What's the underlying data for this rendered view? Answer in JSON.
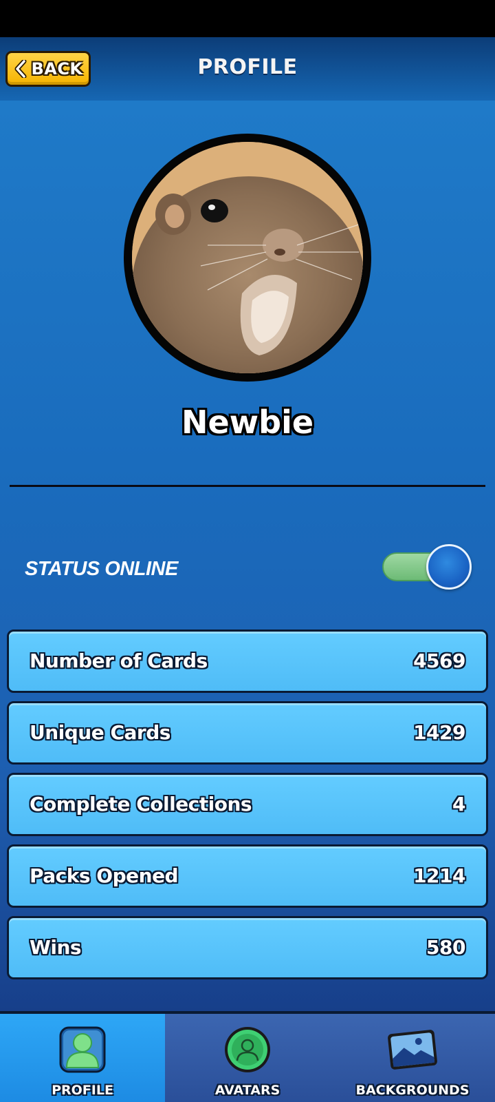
{
  "header": {
    "back_label": "BACK",
    "title": "PROFILE"
  },
  "profile": {
    "avatar_icon": "ground-squirrel-photo",
    "username": "Newbie"
  },
  "status": {
    "label": "STATUS ONLINE",
    "enabled": true,
    "toggle_track_color": "#7cc784",
    "toggle_knob_color": "#1f6fd0"
  },
  "stats": [
    {
      "label": "Number of Cards",
      "value": "4569"
    },
    {
      "label": "Unique Cards",
      "value": "1429"
    },
    {
      "label": "Complete Collections",
      "value": "4"
    },
    {
      "label": "Packs Opened",
      "value": "1214"
    },
    {
      "label": "Wins",
      "value": "580"
    }
  ],
  "tabs": [
    {
      "label": "PROFILE",
      "icon": "person-icon",
      "active": true
    },
    {
      "label": "AVATARS",
      "icon": "avatar-circle-icon",
      "active": false
    },
    {
      "label": "BACKGROUNDS",
      "icon": "landscape-picture-icon",
      "active": false
    }
  ],
  "colors": {
    "accent_yellow": "#f5b300",
    "stat_row": "#5ac4fb",
    "active_tab": "#2ea7f6",
    "background_blue": "#1a6cbd"
  }
}
